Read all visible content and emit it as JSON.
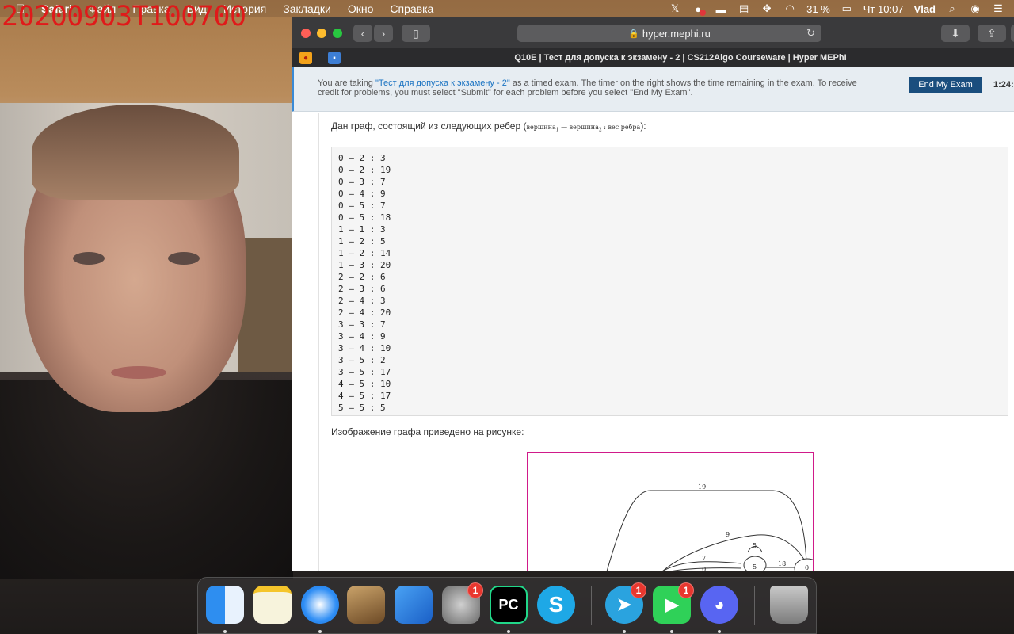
{
  "watermark": "20200903T100700",
  "menubar": {
    "app_name": "Safari",
    "items": [
      "Файл",
      "Правка",
      "Вид",
      "История",
      "Закладки",
      "Окно",
      "Справка"
    ],
    "battery_percent": "31 %",
    "clock": "Чт 10:07",
    "user": "Vlad"
  },
  "browser": {
    "url": "hyper.mephi.ru",
    "tab_title": "Q10E | Тест для допуска к экзамену - 2 | CS212Algo Courseware | Hyper MEPhI"
  },
  "banner": {
    "text_before": "You are taking ",
    "exam_link": "\"Тест для допуска к экзамену - 2\"",
    "text_after": " as a timed exam. The timer on the right shows the time remaining in the exam. To receive credit for problems, you must select \"Submit\" for each problem before you select \"End My Exam\".",
    "end_button": "End My Exam",
    "timer": "1:24:"
  },
  "question": {
    "intro": "Дан граф, состоящий из следующих ребер (",
    "intro_v1": "вершина",
    "intro_sub1": "1",
    "intro_dash": " — ",
    "intro_v2": "вершина",
    "intro_sub2": "2",
    "intro_weight": " : вес ребра",
    "intro_end": "):",
    "edges": [
      "0 — 2 : 3",
      "0 — 2 : 19",
      "0 — 3 : 7",
      "0 — 4 : 9",
      "0 — 5 : 7",
      "0 — 5 : 18",
      "1 — 1 : 3",
      "1 — 2 : 5",
      "1 — 2 : 14",
      "1 — 3 : 20",
      "2 — 2 : 6",
      "2 — 3 : 6",
      "2 — 4 : 3",
      "2 — 4 : 20",
      "3 — 3 : 7",
      "3 — 4 : 9",
      "3 — 4 : 10",
      "3 — 5 : 2",
      "3 — 5 : 17",
      "4 — 5 : 10",
      "4 — 5 : 17",
      "5 — 5 : 5"
    ],
    "image_caption": "Изображение графа приведено на рисунке:",
    "graph_labels": {
      "w19": "19",
      "w9": "9",
      "w5": "5",
      "w17": "17",
      "w10": "10",
      "w18": "18",
      "node5": "5",
      "node0": "0"
    }
  },
  "dock": {
    "telegram_badge": "1",
    "facetime_badge": "1",
    "sysprefs_badge": "1",
    "pycharm_label": "PC"
  }
}
